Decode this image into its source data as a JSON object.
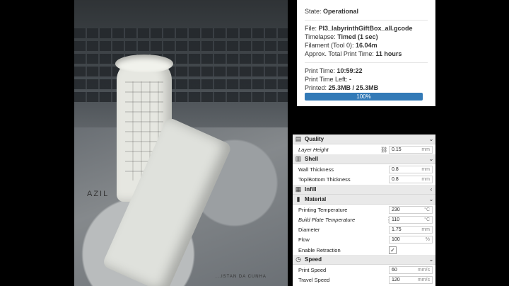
{
  "state": {
    "label": "State:",
    "value": "Operational"
  },
  "job": {
    "file_label": "File:",
    "file": "PI3_labyrinthGiftBox_all.gcode",
    "timelapse_label": "Timelapse:",
    "timelapse": "Timed (1 sec)",
    "filament_label": "Filament (Tool 0):",
    "filament": "16.04m",
    "approx_label": "Approx. Total Print Time:",
    "approx": "11 hours"
  },
  "progress": {
    "print_time_label": "Print Time:",
    "print_time": "10:59:22",
    "time_left_label": "Print Time Left:",
    "time_left": "-",
    "printed_label": "Printed:",
    "printed": "25.3MB / 25.3MB",
    "percent_text": "100%",
    "percent": 100
  },
  "photo_text": {
    "map": "AZIL",
    "map2": "...ISTAN DA CUNHA"
  },
  "settings": {
    "quality": {
      "title": "Quality",
      "layer_height": {
        "label": "Layer Height",
        "value": "0.15",
        "unit": "mm"
      }
    },
    "shell": {
      "title": "Shell",
      "wall_thickness": {
        "label": "Wall Thickness",
        "value": "0.8",
        "unit": "mm"
      },
      "top_bottom": {
        "label": "Top/Bottom Thickness",
        "value": "0.8",
        "unit": "mm"
      }
    },
    "infill": {
      "title": "Infill"
    },
    "material": {
      "title": "Material",
      "print_temp": {
        "label": "Printing Temperature",
        "value": "230",
        "unit": "°C"
      },
      "plate_temp": {
        "label": "Build Plate Temperature",
        "value": "110",
        "unit": "°C"
      },
      "diameter": {
        "label": "Diameter",
        "value": "1.75",
        "unit": "mm"
      },
      "flow": {
        "label": "Flow",
        "value": "100",
        "unit": "%"
      },
      "retraction": {
        "label": "Enable Retraction",
        "checked": true
      }
    },
    "speed": {
      "title": "Speed",
      "print_speed": {
        "label": "Print Speed",
        "value": "60",
        "unit": "mm/s"
      },
      "travel_speed": {
        "label": "Travel Speed",
        "value": "120",
        "unit": "mm/s"
      }
    }
  }
}
